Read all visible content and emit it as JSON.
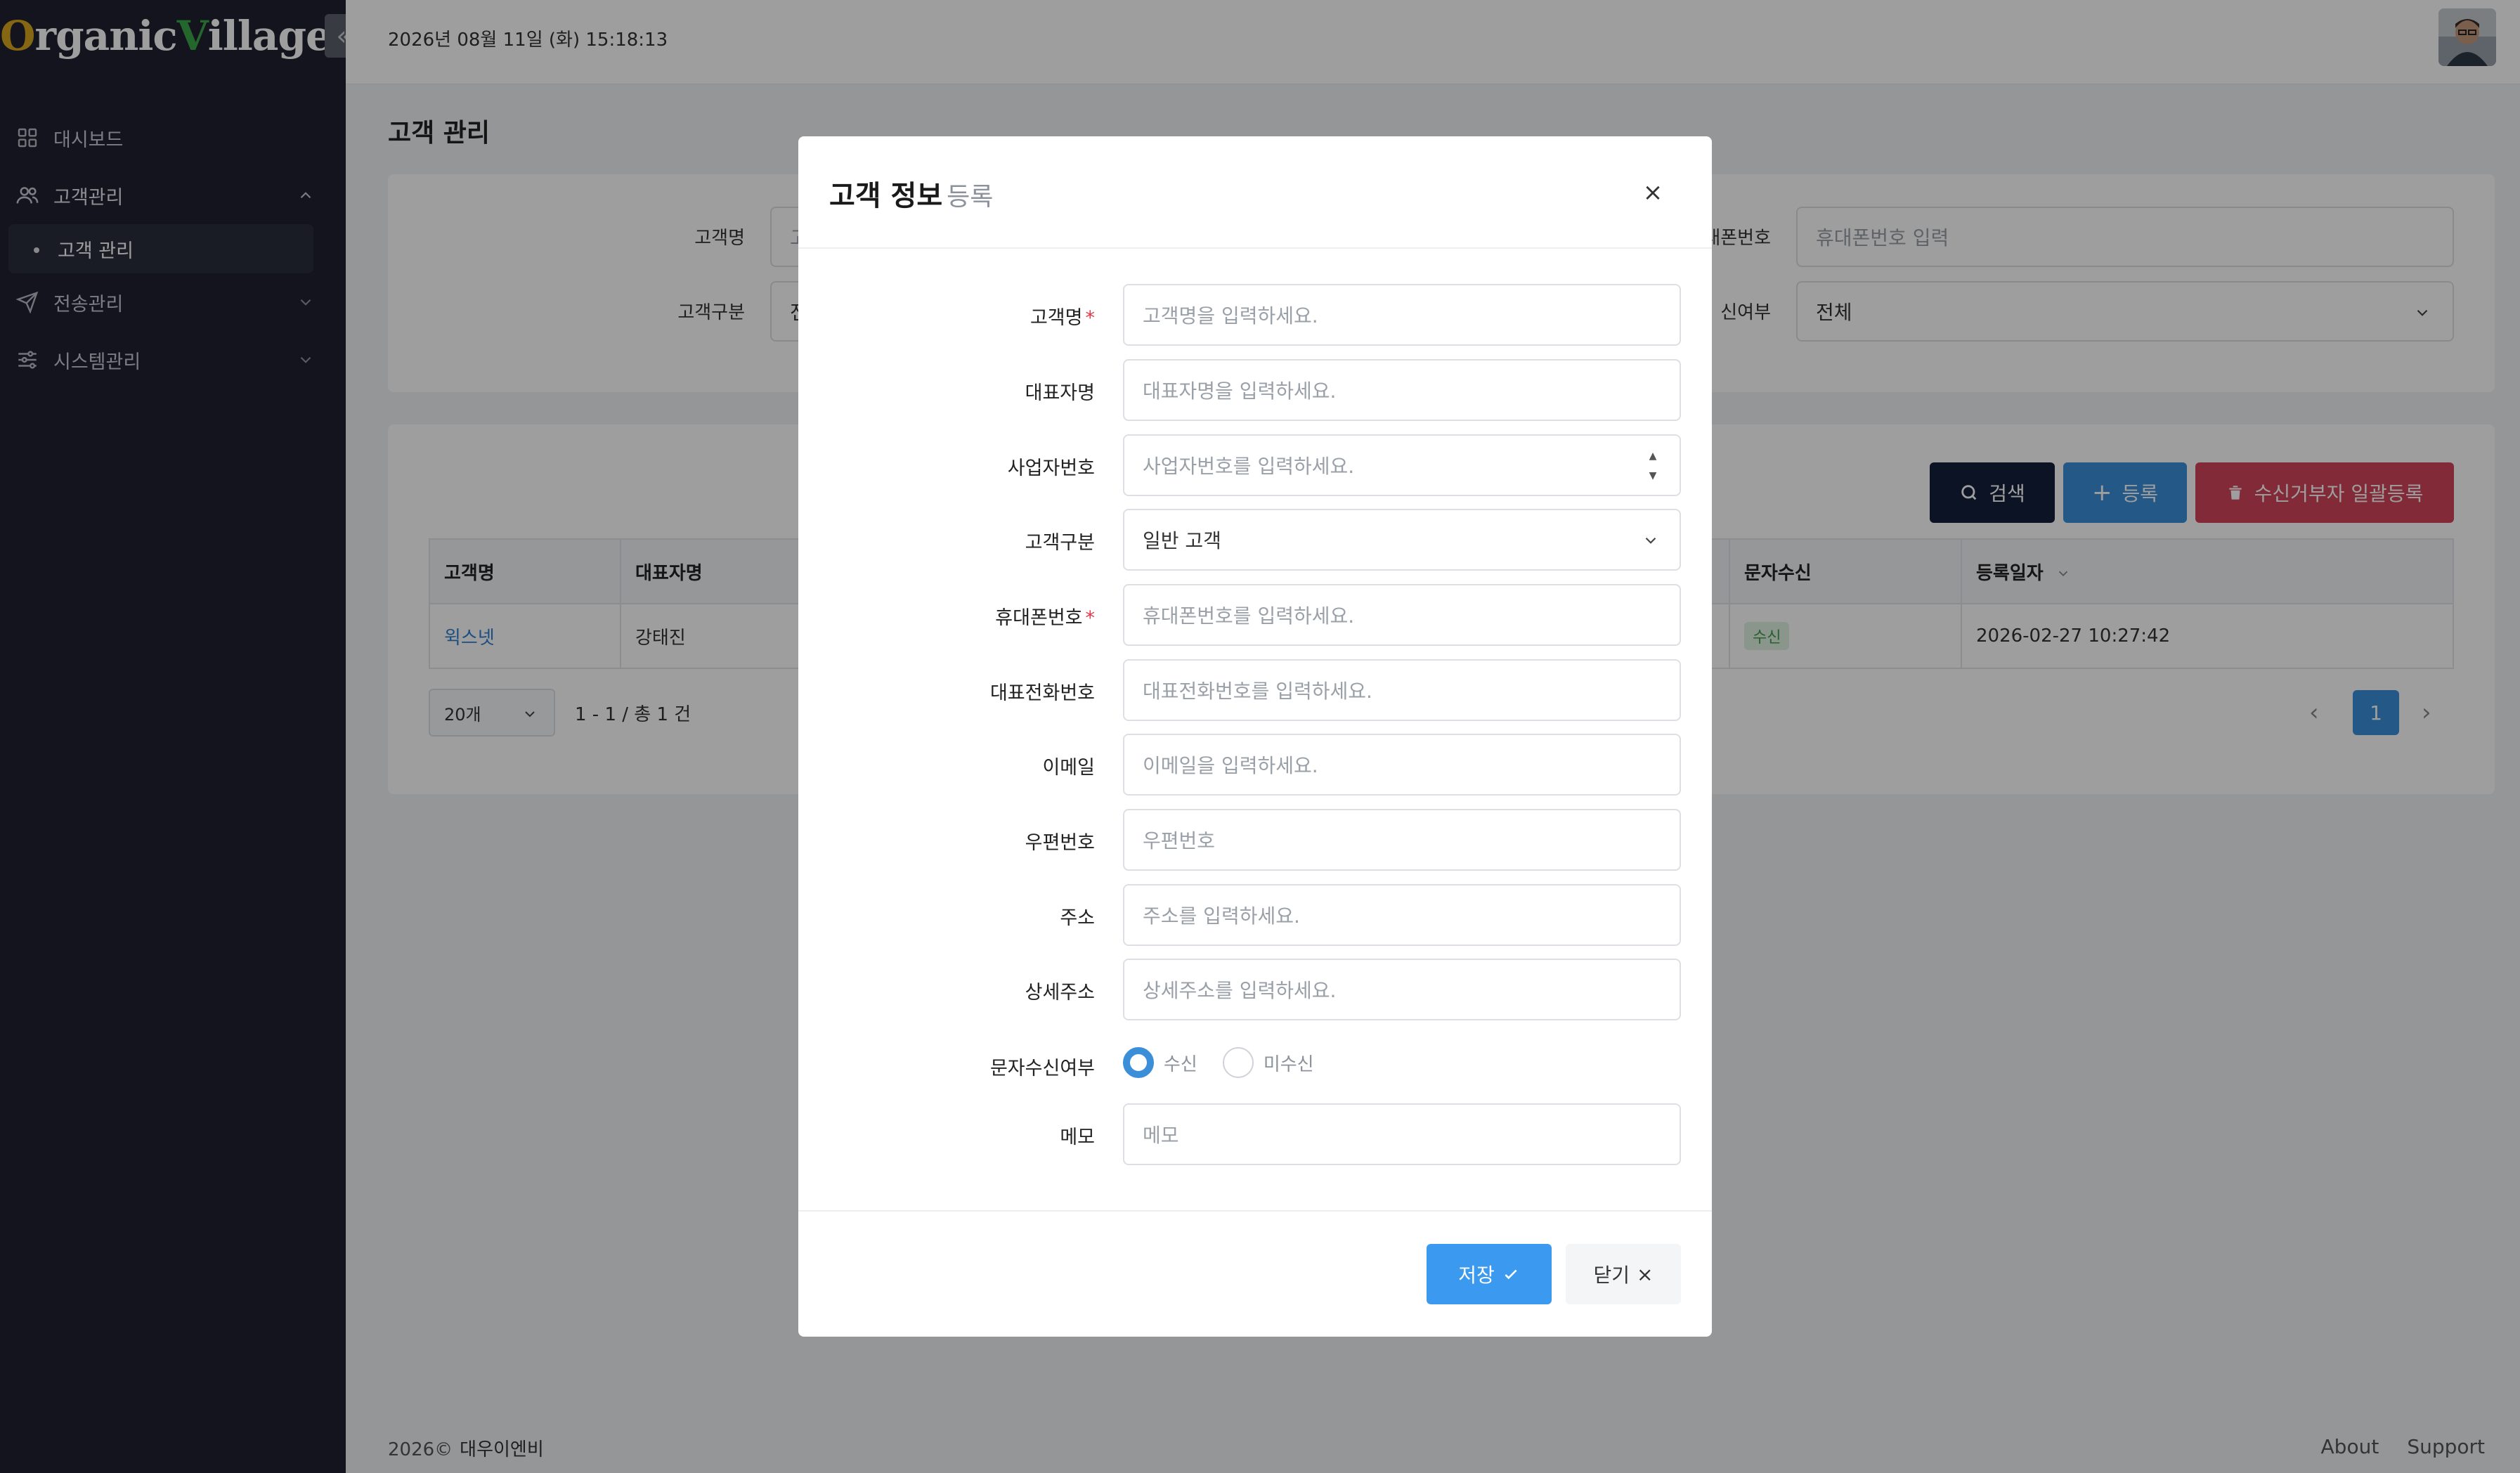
{
  "app": {
    "logo_first_letter": "O",
    "logo_part1": "rganic ",
    "logo_v": "V",
    "logo_part2": "illages"
  },
  "topbar": {
    "datetime": "2026년 08월 11일 (화) 15:18:13"
  },
  "sidebar": {
    "items": [
      {
        "label": "대시보드",
        "icon": "grid-icon"
      },
      {
        "label": "고객관리",
        "icon": "users-icon",
        "expanded": true
      },
      {
        "label": "전송관리",
        "icon": "send-icon"
      },
      {
        "label": "시스템관리",
        "icon": "sliders-icon"
      }
    ],
    "sub_item": "고객 관리"
  },
  "page": {
    "title": "고객 관리"
  },
  "filters": {
    "customer_name_label": "고객명",
    "customer_type_label": "고객구분",
    "phone_label_partial": "대폰번호",
    "phone_placeholder": "휴대폰번호 입력",
    "sms_label_partial": "신여부",
    "sms_value": "전체",
    "name_input_partial": "고",
    "type_input_partial": "전"
  },
  "actions": {
    "search": "검색",
    "add": "등록",
    "bulk_reject": "수신거부자 일괄등록"
  },
  "table": {
    "headers": {
      "name": "고객명",
      "rep": "대표자명",
      "sms": "문자수신",
      "reg_date": "등록일자"
    },
    "rows": [
      {
        "name": "윅스넷",
        "rep": "강태진",
        "sms": "수신",
        "reg_date": "2026-02-27 10:27:42"
      }
    ]
  },
  "pagination": {
    "page_size": "20개",
    "info": "1 - 1 / 총 1 건",
    "current": "1"
  },
  "footer": {
    "copyright": "2026©",
    "company": "대우이엔비",
    "about": "About",
    "support": "Support"
  },
  "modal": {
    "title": "고객 정보",
    "subtitle": "등록",
    "fields": {
      "name": {
        "label": "고객명",
        "placeholder": "고객명을 입력하세요."
      },
      "rep": {
        "label": "대표자명",
        "placeholder": "대표자명을 입력하세요."
      },
      "biz": {
        "label": "사업자번호",
        "placeholder": "사업자번호를 입력하세요."
      },
      "type": {
        "label": "고객구분",
        "value": "일반 고객"
      },
      "phone": {
        "label": "휴대폰번호",
        "placeholder": "휴대폰번호를 입력하세요."
      },
      "tel": {
        "label": "대표전화번호",
        "placeholder": "대표전화번호를 입력하세요."
      },
      "email": {
        "label": "이메일",
        "placeholder": "이메일을 입력하세요."
      },
      "zip": {
        "label": "우편번호",
        "placeholder": "우편번호"
      },
      "addr": {
        "label": "주소",
        "placeholder": "주소를 입력하세요."
      },
      "addr2": {
        "label": "상세주소",
        "placeholder": "상세주소를 입력하세요."
      },
      "sms": {
        "label": "문자수신여부",
        "on": "수신",
        "off": "미수신"
      },
      "memo": {
        "label": "메모",
        "placeholder": "메모"
      }
    },
    "save": "저장",
    "close": "닫기"
  },
  "colors": {
    "primary": "#3b8ed8",
    "danger": "#d2455b",
    "dark": "#12203a",
    "sidebar": "#1f2130"
  }
}
